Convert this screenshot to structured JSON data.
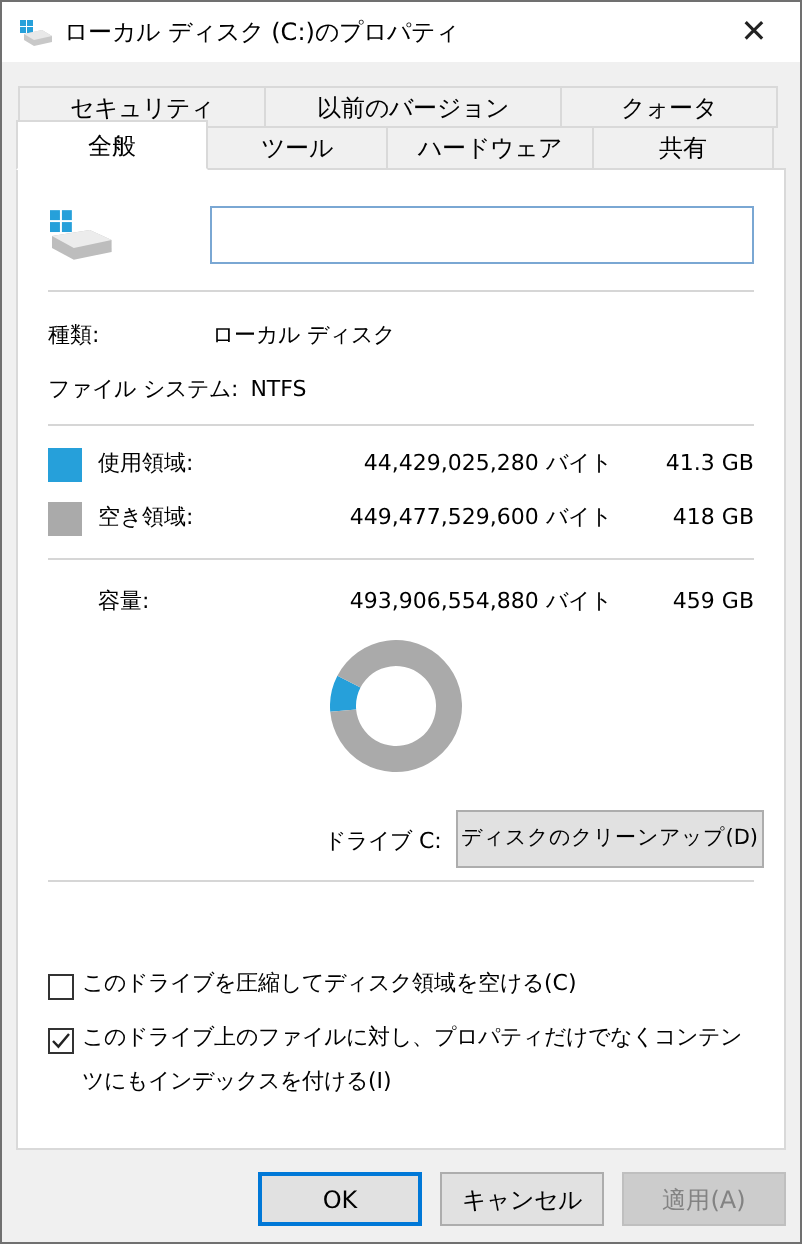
{
  "window": {
    "title": "ローカル ディスク (C:)のプロパティ",
    "close": "✕"
  },
  "tabs_back": [
    {
      "label": "セキュリティ",
      "selected": false
    },
    {
      "label": "以前のバージョン",
      "selected": false
    },
    {
      "label": "クォータ",
      "selected": false
    }
  ],
  "tabs_front": [
    {
      "label": "全般",
      "selected": true
    },
    {
      "label": "ツール",
      "selected": false
    },
    {
      "label": "ハードウェア",
      "selected": false
    },
    {
      "label": "共有",
      "selected": false
    }
  ],
  "name_field": {
    "kind": "text"
  },
  "info": [
    {
      "label": "種類:",
      "value": "ローカル ディスク"
    },
    {
      "label": "ファイル システム:",
      "value": "NTFS"
    }
  ],
  "space": [
    {
      "label": "使用領域:",
      "bytes": "44,429,025,280 バイト",
      "size": "41.3 GB",
      "color": "#26a0da"
    },
    {
      "label": "空き領域:",
      "bytes": "449,477,529,600 バイト",
      "size": "418 GB",
      "color": "#aaaaaa"
    }
  ],
  "capacity": {
    "label": "容量:",
    "bytes": "493,906,554,880 バイト",
    "size": "459 GB"
  },
  "chart_data": {
    "type": "donut",
    "values": [
      9,
      91
    ]
  },
  "drive_label": "ドライブ C:",
  "cleanup_button": "ディスクのクリーンアップ(D)",
  "options": [
    {
      "label": "このドライブを圧縮してディスク領域を空ける(C)",
      "checked": false
    },
    {
      "label": "このドライブ上のファイルに対し、プロパティだけでなくコンテンツにもインデックスを付ける(I)",
      "checked": true
    }
  ],
  "buttons": [
    {
      "label": "OK",
      "kind": "default",
      "disabled": false
    },
    {
      "label": "キャンセル",
      "kind": "normal",
      "disabled": false
    },
    {
      "label": "適用(A)",
      "kind": "normal",
      "disabled": true
    }
  ]
}
